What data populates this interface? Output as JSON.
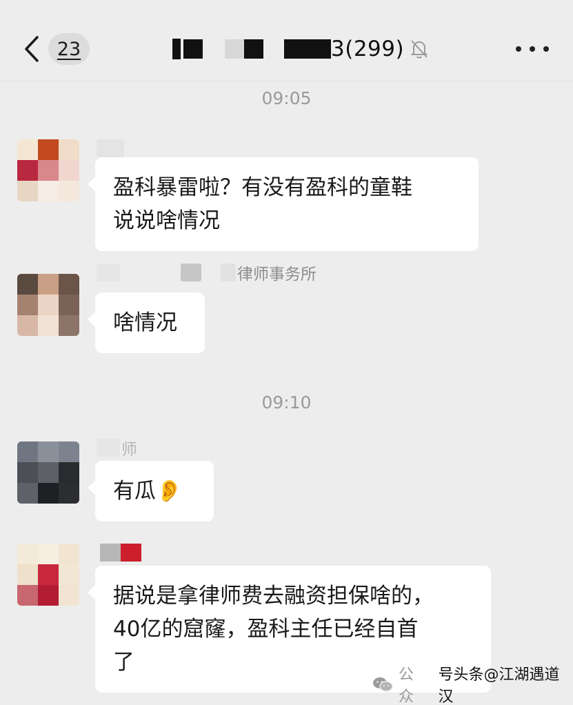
{
  "header": {
    "unread_count": "23",
    "title_suffix": "3(299)",
    "icons": {
      "back": "chevron-left-icon",
      "mute": "bell-slash-icon",
      "more": "more-dots-icon"
    }
  },
  "messages": [
    {
      "timestamp": "09:05"
    },
    {
      "sender": "",
      "lines": [
        "盈科暴雷啦？有没有盈科的童鞋",
        "说说啥情况"
      ]
    },
    {
      "sender": "律师事务所",
      "lines": [
        "啥情况"
      ]
    },
    {
      "timestamp": "09:10"
    },
    {
      "sender": "师",
      "lines": [
        "有瓜👂"
      ]
    },
    {
      "sender": "",
      "lines": [
        "据说是拿律师费去融资担保啥的，",
        "40亿的窟窿，盈科主任已经自首",
        "了"
      ]
    }
  ],
  "watermark": {
    "prefix": "公众",
    "handle": "号头条@江湖遇道汉",
    "icon": "wechat-icon"
  },
  "colors": {
    "background": "#ededed",
    "bubble": "#ffffff",
    "timestamp": "#9a9a9a",
    "sender": "#8c8c8c"
  }
}
